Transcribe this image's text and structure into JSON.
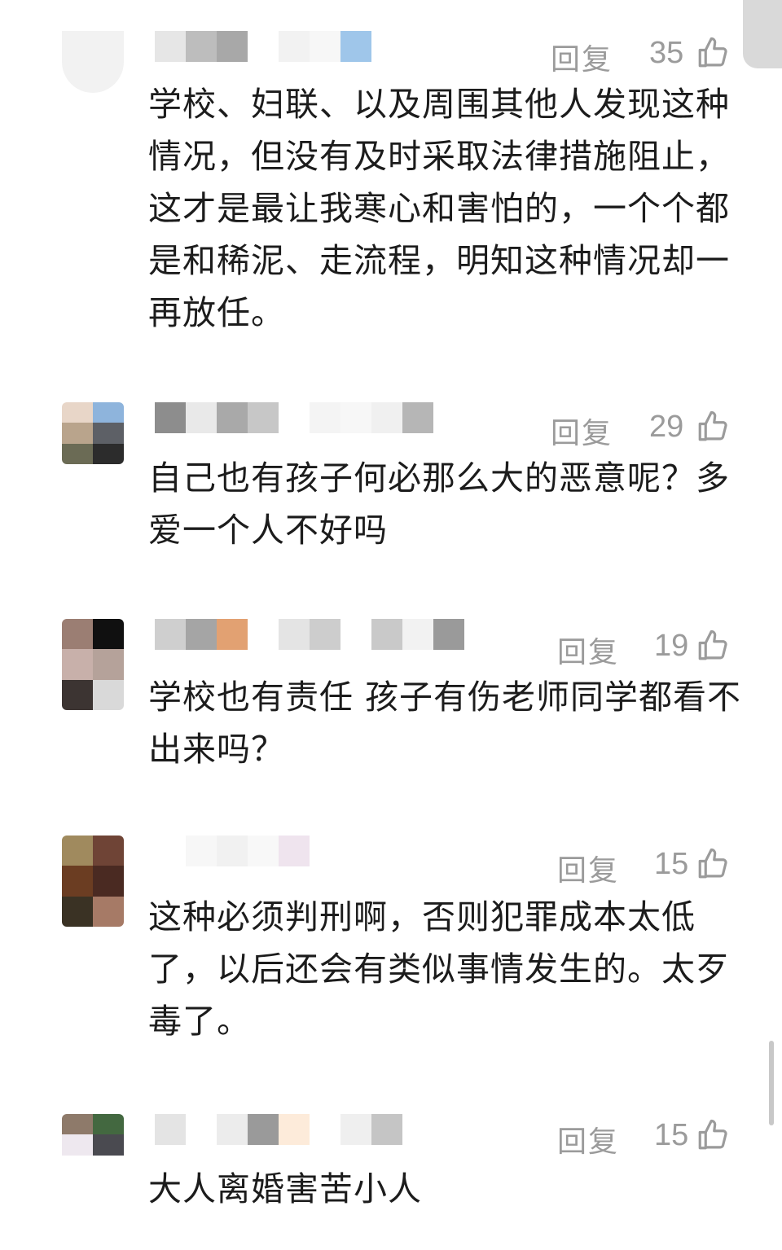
{
  "comments": [
    {
      "reply_label": "回复",
      "likes": "35",
      "text": "学校、妇联、以及周围其他人发现这种情况，但没有及时采取法律措施阻止，这才是最让我寒心和害怕的，一个个都是和稀泥、走流程，明知这种情况却一再放任。",
      "avatar_colors": [],
      "name_colors": [
        "#e6e6e6",
        "#bdbdbd",
        "#a8a8a8",
        "#ffffff",
        "#f2f2f2",
        "#f7f7f7",
        "#9fc6ea"
      ]
    },
    {
      "reply_label": "回复",
      "likes": "29",
      "text": "自己也有孩子何必那么大的恶意呢？多爱一个人不好吗",
      "avatar_colors": [
        "#e8d6c8",
        "#8eb4dc",
        "#b9a48c",
        "#5d6066",
        "#6b6b55",
        "#2c2c2c"
      ],
      "name_colors": [
        "#8d8d8d",
        "#e9e9e9",
        "#a9a9a9",
        "#c7c7c7",
        "#ffffff",
        "#f4f4f4",
        "#f7f7f7",
        "#f0f0f0",
        "#b6b6b6"
      ]
    },
    {
      "reply_label": "回复",
      "likes": "19",
      "text": "学校也有责任  孩子有伤老师同学都看不出来吗？",
      "avatar_colors": [
        "#9b7e73",
        "#101010",
        "#c8b0aa",
        "#b5a29a",
        "#3c3432",
        "#d9d9d9"
      ],
      "name_colors": [
        "#cfcfcf",
        "#a5a5a5",
        "#e2a172",
        "#ffffff",
        "#e4e4e4",
        "#cdcdcd",
        "#ffffff",
        "#c9c9c9",
        "#f2f2f2",
        "#9a9a9a"
      ]
    },
    {
      "reply_label": "回复",
      "likes": "15",
      "text": "这种必须判刑啊，否则犯罪成本太低了，以后还会有类似事情发生的。太歹毒了。",
      "avatar_colors": [
        "#a08a5e",
        "#6f4436",
        "#6b3d22",
        "#4a2a22",
        "#3a3224",
        "#a67a66"
      ],
      "name_colors": [
        "#ffffff",
        "#f7f7f7",
        "#f1f1f1",
        "#f8f8f8",
        "#efe4ee",
        "#ffffff"
      ]
    },
    {
      "reply_label": "回复",
      "likes": "15",
      "text": "大人离婚害苦小人",
      "avatar_colors": [
        "#8e7a6a",
        "#436840",
        "#eee8ef",
        "#4a4a50",
        "#ffffff",
        "#ffffff"
      ],
      "name_colors": [
        "#e4e4e4",
        "#ffffff",
        "#ececec",
        "#9a9a9a",
        "#fdebda",
        "#ffffff",
        "#efefef",
        "#c5c5c5"
      ]
    }
  ]
}
